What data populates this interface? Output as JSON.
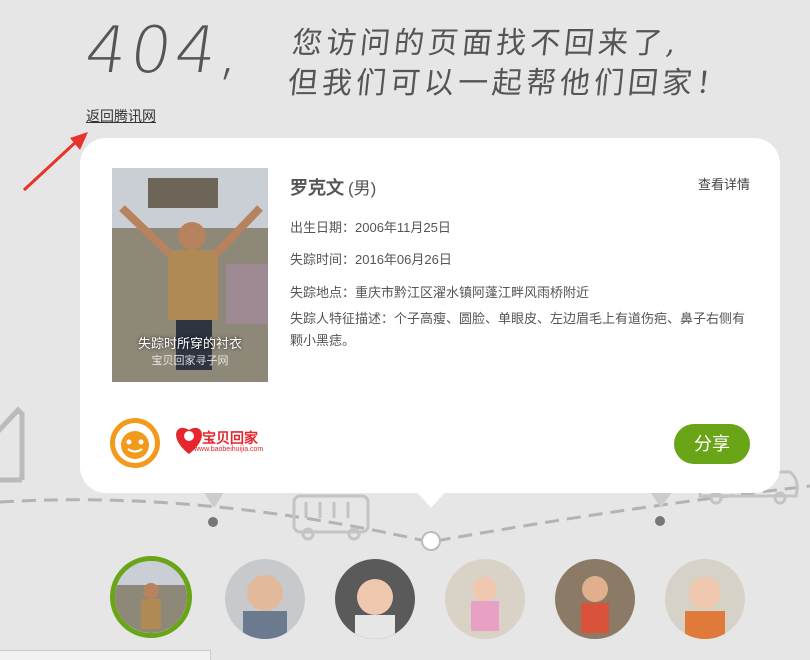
{
  "header": {
    "code": "404,",
    "line1": "您访问的页面找不回来了,",
    "line2": "但我们可以一起帮他们回家！",
    "back_link": "返回腾讯网"
  },
  "person": {
    "name": "罗克文",
    "gender": "(男)",
    "details_link": "查看详情",
    "birth": "出生日期：2006年11月25日",
    "missing_time": "失踪时间：2016年06月26日",
    "missing_place": "失踪地点：重庆市黔江区濯水镇阿蓬江畔风雨桥附近",
    "features": "失踪人特征描述：个子高瘦、圆脸、单眼皮、左边眉毛上有道伤疤、鼻子右侧有颗小黑痣。",
    "photo_caption": "失踪时所穿的衬衣",
    "photo_watermark": "宝贝回家寻子网"
  },
  "logos": {
    "baobei_name": "宝贝回家",
    "baobei_url": "www.baobeihuijia.com"
  },
  "share_label": "分享",
  "colors": {
    "accent": "#6aa517",
    "background": "#e6e6e6",
    "card": "#ffffff",
    "arrow": "#e8322a"
  },
  "thumbnails": [
    {
      "name": "thumb-1",
      "active": true
    },
    {
      "name": "thumb-2",
      "active": false
    },
    {
      "name": "thumb-3",
      "active": false
    },
    {
      "name": "thumb-4",
      "active": false
    },
    {
      "name": "thumb-5",
      "active": false
    },
    {
      "name": "thumb-6",
      "active": false
    }
  ]
}
